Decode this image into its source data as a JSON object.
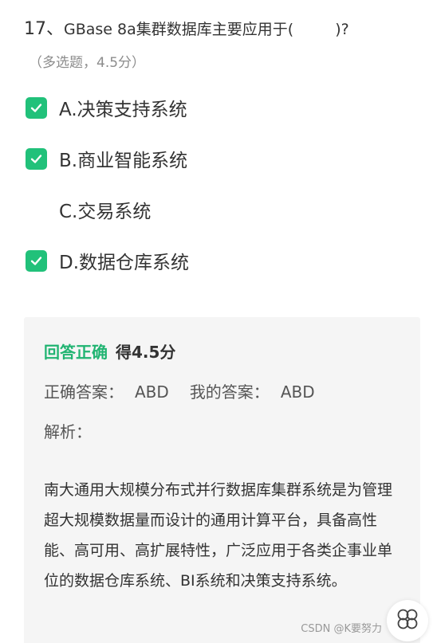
{
  "question": {
    "number": "17、",
    "text_before": "GBase 8a集群数据库主要应用于(",
    "text_after": ")?",
    "type": "（多选题，4.5分）"
  },
  "options": [
    {
      "label": "A.决策支持系统",
      "checked": true
    },
    {
      "label": "B.商业智能系统",
      "checked": true
    },
    {
      "label": "C.交易系统",
      "checked": false
    },
    {
      "label": "D.数据仓库系统",
      "checked": true
    }
  ],
  "result": {
    "status": "回答正确",
    "score": "得4.5分",
    "correct_label": "正确答案：",
    "correct_answer": "ABD",
    "my_label": "我的答案：",
    "my_answer": "ABD",
    "analysis_label": "解析：",
    "analysis_text": "南大通用大规模分布式并行数据库集群系统是为管理超大规模数据量而设计的通用计算平台，具备高性能、高可用、高扩展特性，广泛应用于各类企事业单位的数据仓库系统、BI系统和决策支持系统。"
  },
  "watermark": "CSDN @K要努力",
  "colors": {
    "accent_green": "#21c17a",
    "status_green": "#21b472",
    "panel_bg": "#f5f5f5"
  },
  "icons": {
    "check": "check-icon",
    "float": "clover-icon"
  }
}
